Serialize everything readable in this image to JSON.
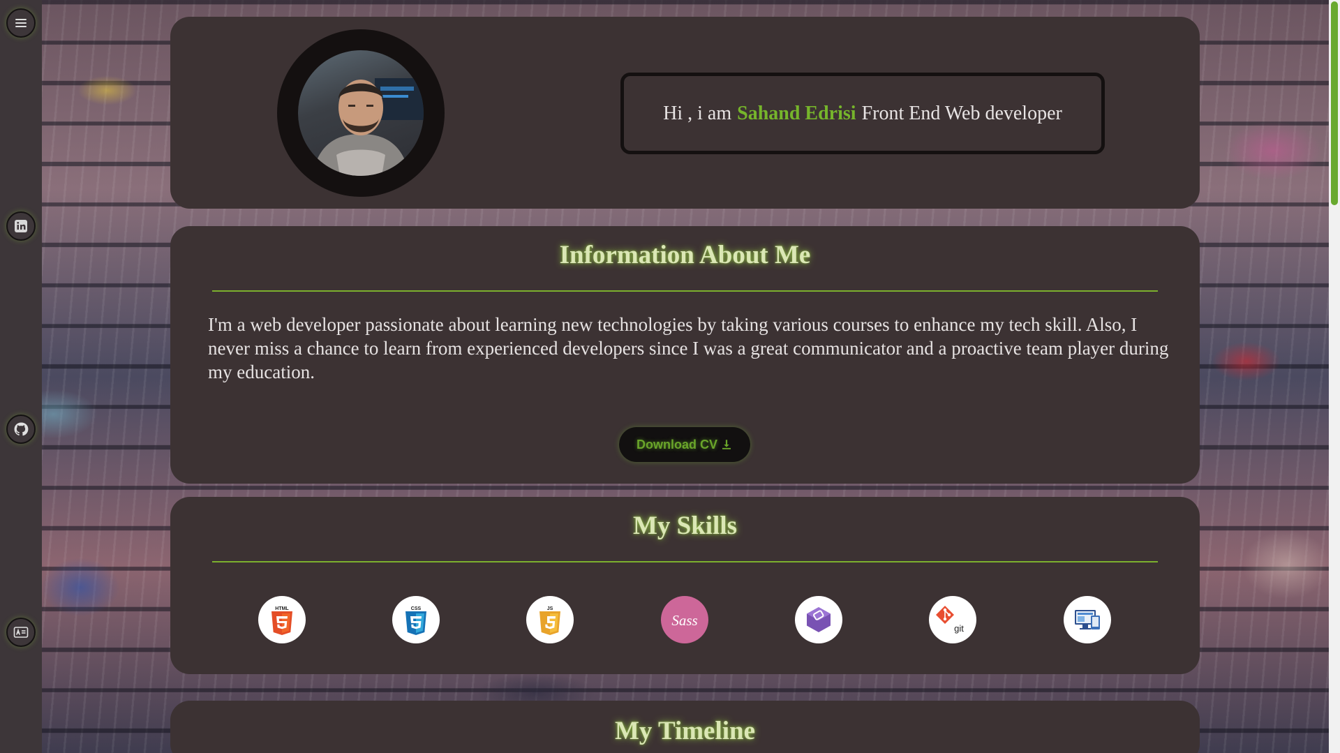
{
  "sidebar": {
    "items": [
      {
        "icon": "hamburger-menu-icon"
      },
      {
        "icon": "linkedin-icon"
      },
      {
        "icon": "github-icon"
      },
      {
        "icon": "contact-card-icon"
      }
    ]
  },
  "hero": {
    "greeting_prefix": "Hi , i am",
    "name": "Sahand Edrisi",
    "greeting_suffix": "Front End Web developer"
  },
  "info": {
    "title": "Information About Me",
    "text": "I'm a web developer passionate about learning new technologies by taking various courses to enhance my tech skill. Also, I never miss a chance to learn from experienced developers since I was a great communicator and a proactive team player during my education.",
    "download_label": "Download CV"
  },
  "skills": {
    "title": "My Skills",
    "items": [
      {
        "icon": "html5-icon",
        "label": "HTML"
      },
      {
        "icon": "css3-icon",
        "label": "CSS"
      },
      {
        "icon": "javascript-icon",
        "label": "JS"
      },
      {
        "icon": "sass-icon",
        "label": "Sass"
      },
      {
        "icon": "bootstrap-icon",
        "label": ""
      },
      {
        "icon": "git-icon",
        "label": "git"
      },
      {
        "icon": "responsive-design-icon",
        "label": ""
      }
    ]
  },
  "timeline": {
    "title": "My Timeline"
  },
  "colors": {
    "accent": "#76b52b",
    "card": "#3c3233",
    "sidebar": "#3d3639",
    "title_glow": "#dbe7b5"
  }
}
